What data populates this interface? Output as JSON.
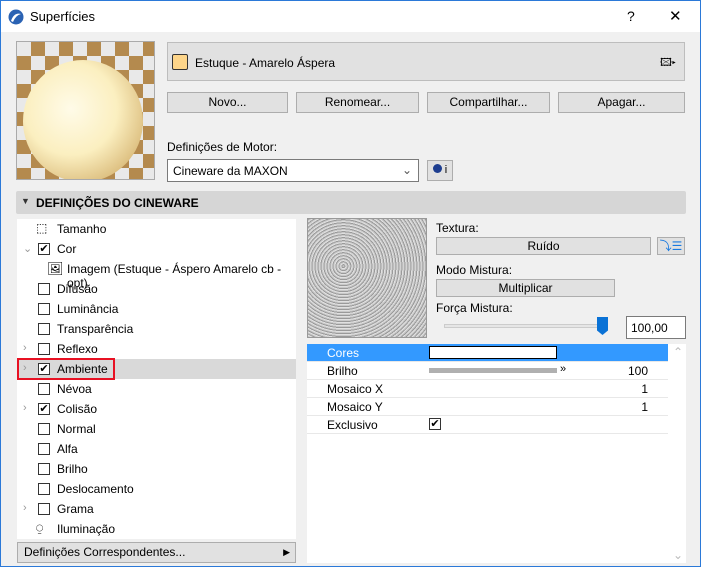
{
  "window": {
    "title": "Superfícies",
    "help": "?",
    "close": "✕"
  },
  "material": {
    "name": "Estuque - Amarelo Áspera",
    "swatch_color": "#fdd58a"
  },
  "buttons": {
    "new": "Novo...",
    "rename": "Renomear...",
    "share": "Compartilhar...",
    "delete": "Apagar..."
  },
  "engine": {
    "label": "Definições de Motor:",
    "value": "Cineware da MAXON",
    "info": "i"
  },
  "section": {
    "title": "DEFINIÇÕES DO CINEWARE"
  },
  "channels": [
    {
      "label": "Tamanho",
      "type": "icon",
      "icon": "size-icon"
    },
    {
      "label": "Cor",
      "checked": true,
      "expander": "expanded"
    },
    {
      "label": "Imagem (Estuque - Áspero Amarelo cb -opt)",
      "type": "image"
    },
    {
      "label": "Difusão",
      "checked": false
    },
    {
      "label": "Luminância",
      "checked": false
    },
    {
      "label": "Transparência",
      "checked": false
    },
    {
      "label": "Reflexo",
      "checked": false,
      "expander": "collapsed"
    },
    {
      "label": "Ambiente",
      "checked": true,
      "expander": "collapsed",
      "selected": true
    },
    {
      "label": "Névoa",
      "checked": false
    },
    {
      "label": "Colisão",
      "checked": true,
      "expander": "collapsed"
    },
    {
      "label": "Normal",
      "checked": false
    },
    {
      "label": "Alfa",
      "checked": false
    },
    {
      "label": "Brilho",
      "checked": false
    },
    {
      "label": "Deslocamento",
      "checked": false
    },
    {
      "label": "Grama",
      "checked": false,
      "expander": "collapsed"
    },
    {
      "label": "Iluminação",
      "type": "icon",
      "icon": "lightbulb-icon"
    }
  ],
  "matching": {
    "label": "Definições Correspondentes..."
  },
  "texture": {
    "label": "Textura:",
    "value": "Ruído",
    "blend_label": "Modo Mistura:",
    "blend_value": "Multiplicar",
    "strength_label": "Força Mistura:",
    "strength_value": "100,00",
    "strength_percent": 100
  },
  "properties": [
    {
      "key": "Cores",
      "value": "",
      "type": "color",
      "color": "#ffffff"
    },
    {
      "key": "Brilho",
      "value": "100",
      "type": "slider",
      "percent": 100
    },
    {
      "key": "Mosaico X",
      "value": "1"
    },
    {
      "key": "Mosaico Y",
      "value": "1"
    },
    {
      "key": "Exclusivo",
      "value": "",
      "type": "checkbox",
      "checked": true
    }
  ],
  "colors": {
    "accent": "#3399ff",
    "highlight": "#e81123"
  }
}
